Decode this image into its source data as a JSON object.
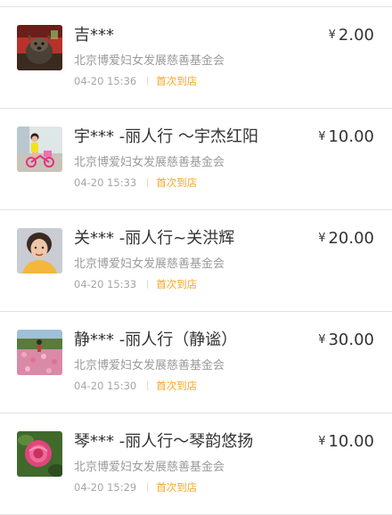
{
  "donations": [
    {
      "name": "吉***",
      "currency": "¥",
      "amount": "2.00",
      "org": "北京博爱妇女发展慈善基金会",
      "time": "04-20 15:36",
      "tag": "首次到店",
      "avatar": "avatar-dog-red-background",
      "tag_color": "#f5a623"
    },
    {
      "name": "宇*** -丽人行 ～宇杰红阳",
      "currency": "¥",
      "amount": "10.00",
      "org": "北京博爱妇女发展慈善基金会",
      "time": "04-20 15:33",
      "tag": "首次到店",
      "avatar": "avatar-child-on-bike",
      "tag_color": "#f5a623"
    },
    {
      "name": "关*** -丽人行~关洪辉",
      "currency": "¥",
      "amount": "20.00",
      "org": "北京博爱妇女发展慈善基金会",
      "time": "04-20 15:33",
      "tag": "首次到店",
      "avatar": "avatar-woman-portrait",
      "tag_color": "#f5a623"
    },
    {
      "name": "静*** -丽人行（静谧）",
      "currency": "¥",
      "amount": "30.00",
      "org": "北京博爱妇女发展慈善基金会",
      "time": "04-20 15:30",
      "tag": "首次到店",
      "avatar": "avatar-flower-field",
      "tag_color": "#f5a623"
    },
    {
      "name": "琴*** -丽人行～琴韵悠扬",
      "currency": "¥",
      "amount": "10.00",
      "org": "北京博爱妇女发展慈善基金会",
      "time": "04-20 15:29",
      "tag": "首次到店",
      "avatar": "avatar-pink-rose",
      "tag_color": "#f5a623"
    }
  ]
}
